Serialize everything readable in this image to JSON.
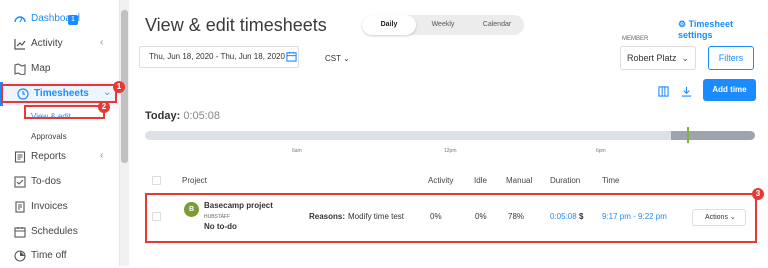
{
  "sidebar": {
    "items": [
      {
        "label": "Dashboard",
        "icon": "dashboard-icon"
      },
      {
        "label": "Activity",
        "icon": "activity-chart-icon",
        "chevron": "‹"
      },
      {
        "label": "Map",
        "icon": "map-icon"
      },
      {
        "label": "Timesheets",
        "icon": "clock-icon",
        "chevron": "⌄"
      },
      {
        "label": "View & edit"
      },
      {
        "label": "Approvals"
      },
      {
        "label": "Reports",
        "icon": "report-icon",
        "chevron": "‹"
      },
      {
        "label": "To-dos",
        "icon": "checklist-icon"
      },
      {
        "label": "Invoices",
        "icon": "invoice-icon"
      },
      {
        "label": "Schedules",
        "icon": "calendar-icon"
      },
      {
        "label": "Time off",
        "icon": "time-off-icon"
      }
    ],
    "dashboard_badge": "1"
  },
  "annotations": {
    "step1": "1",
    "step2": "2",
    "step3": "3"
  },
  "header": {
    "title": "View & edit timesheets",
    "view_tabs": [
      "Daily",
      "Weekly",
      "Calendar"
    ],
    "active_tab": "Daily",
    "settings_link": "Timesheet settings"
  },
  "filters": {
    "date_range": "Thu, Jun 18, 2020 - Thu, Jun 18, 2020",
    "timezone": "CST",
    "member_label": "MEMBER",
    "member_value": "Robert Platz",
    "filters_button": "Filters",
    "add_time_button": "Add time"
  },
  "summary": {
    "today_label": "Today:",
    "today_value": "0:05:08"
  },
  "timeline": {
    "ticks": [
      "6am",
      "12pm",
      "6pm"
    ],
    "tracked_fraction_start": 0.888
  },
  "table": {
    "headers": {
      "project": "Project",
      "activity": "Activity",
      "idle": "Idle",
      "manual": "Manual",
      "duration": "Duration",
      "time": "Time"
    },
    "rows": [
      {
        "avatar": "B",
        "project": "Basecamp project",
        "org": "HUBSTAFF",
        "todo": "No to-do",
        "reasons_label": "Reasons:",
        "reasons": "Modify time test",
        "activity": "0%",
        "idle": "0%",
        "manual": "78%",
        "duration": "0:05:08",
        "duration_suffix": "$",
        "time": "9:17 pm - 9:22 pm",
        "actions": "Actions"
      }
    ]
  },
  "colors": {
    "accent": "#1a8cff",
    "annotation": "#e53935",
    "avatar": "#7a9b35"
  }
}
